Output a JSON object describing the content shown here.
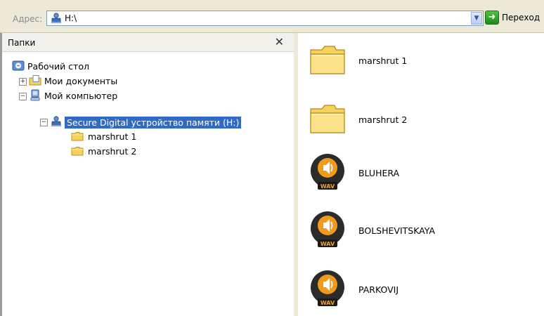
{
  "address_bar": {
    "label": "Адрес:",
    "path": "H:\\",
    "go_label": "Переход"
  },
  "folders_pane": {
    "title": "Папки",
    "tree": [
      {
        "label": "Рабочий стол"
      },
      {
        "label": "Мои документы",
        "expander": "+"
      },
      {
        "label": "Мой компьютер",
        "expander": "−"
      },
      {
        "label": "Secure Digital устройство памяти (H:)",
        "expander": "−",
        "selected": true
      },
      {
        "label": "marshrut 1"
      },
      {
        "label": "marshrut 2"
      }
    ]
  },
  "files_pane": {
    "items": [
      {
        "name": "marshrut 1",
        "icon": "folder-icon"
      },
      {
        "name": "marshrut 2",
        "icon": "folder-icon"
      },
      {
        "name": "BLUHERA",
        "icon": "wav-audio-icon",
        "badge": "WAV"
      },
      {
        "name": "BOLSHEVITSKAYA",
        "icon": "wav-audio-icon",
        "badge": "WAV"
      },
      {
        "name": "PARKOVIJ",
        "icon": "wav-audio-icon",
        "badge": "WAV"
      }
    ]
  },
  "colors": {
    "selection": "#316ac5",
    "toolbar_bg": "#ece9d8",
    "folder_yellow": "#f6d25a"
  }
}
